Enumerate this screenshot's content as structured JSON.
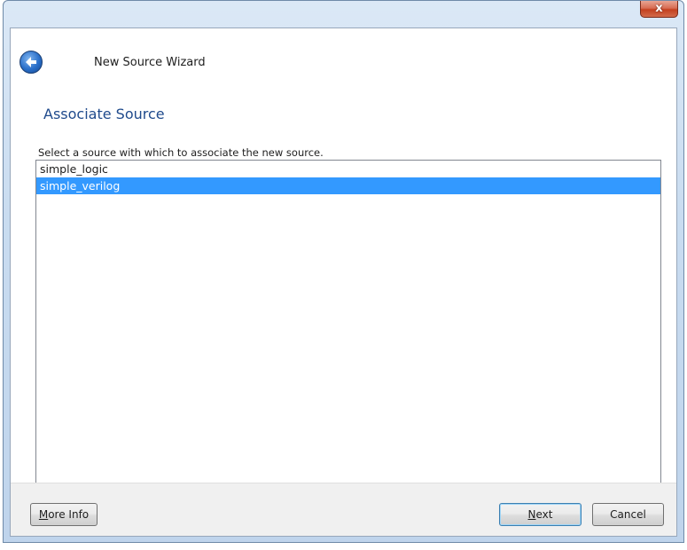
{
  "window": {
    "close_glyph": "x",
    "title": "New Source Wizard"
  },
  "header": {
    "back_icon": "back-arrow-icon"
  },
  "page": {
    "heading": "Associate Source",
    "instruction": "Select a source with which to associate the new source."
  },
  "sources": {
    "items": [
      {
        "label": "simple_logic",
        "selected": false
      },
      {
        "label": "simple_verilog",
        "selected": true
      }
    ]
  },
  "footer": {
    "more_info_first": "M",
    "more_info_rest": "ore Info",
    "next_first": "N",
    "next_rest": "ext",
    "cancel_label": "Cancel"
  },
  "colors": {
    "selection": "#3399ff",
    "heading": "#1f4a8c"
  }
}
